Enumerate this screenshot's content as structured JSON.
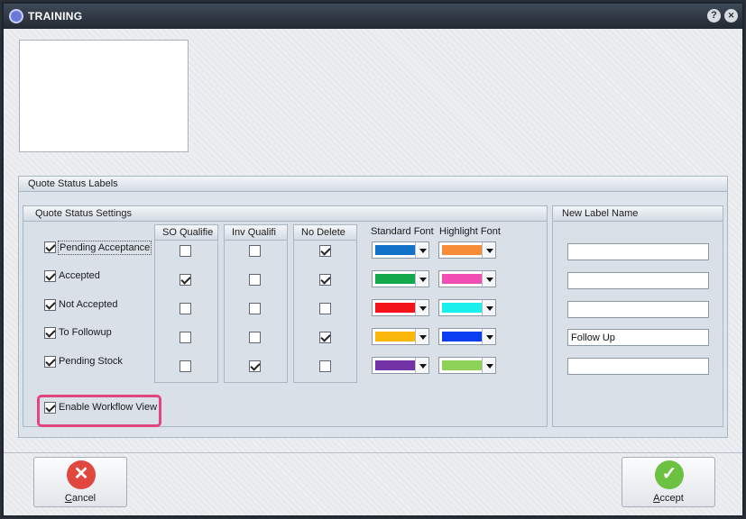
{
  "window": {
    "title": "TRAINING",
    "help_glyph": "?",
    "close_glyph": "✕"
  },
  "group": {
    "title": "Quote Status Labels"
  },
  "settings": {
    "title": "Quote Status Settings",
    "columns": {
      "so_qualified": "SO Qualifie",
      "inv_qualified": "Inv Qualifi",
      "no_delete": "No Delete",
      "standard_font": "Standard Font",
      "highlight_font": "Highlight Font"
    },
    "rows": [
      {
        "label": "Pending Acceptance",
        "enabled": true,
        "so": false,
        "inv": false,
        "nodel": true,
        "std_color": "#1272c9",
        "hl_color": "#f68c38"
      },
      {
        "label": "Accepted",
        "enabled": true,
        "so": true,
        "inv": false,
        "nodel": true,
        "std_color": "#13a84b",
        "hl_color": "#f04eb3"
      },
      {
        "label": "Not Accepted",
        "enabled": true,
        "so": false,
        "inv": false,
        "nodel": false,
        "std_color": "#f2141a",
        "hl_color": "#19f0ee"
      },
      {
        "label": "To Followup",
        "enabled": true,
        "so": false,
        "inv": false,
        "nodel": true,
        "std_color": "#fbb80a",
        "hl_color": "#0c3ef1"
      },
      {
        "label": "Pending Stock",
        "enabled": true,
        "so": false,
        "inv": true,
        "nodel": false,
        "std_color": "#7232a6",
        "hl_color": "#8ed258"
      }
    ],
    "enable_workflow_label": "Enable Workflow View",
    "enable_workflow_checked": true
  },
  "new_label": {
    "title": "New Label Name",
    "values": [
      "",
      "",
      "",
      "Follow Up",
      ""
    ]
  },
  "buttons": {
    "cancel_label_first": "C",
    "cancel_label_rest": "ancel",
    "cancel_icon_glyph": "✕",
    "accept_label_first": "A",
    "accept_label_rest": "ccept",
    "accept_icon_glyph": "✓",
    "cancel_color": "#e0473f",
    "accept_color": "#6cc142"
  }
}
